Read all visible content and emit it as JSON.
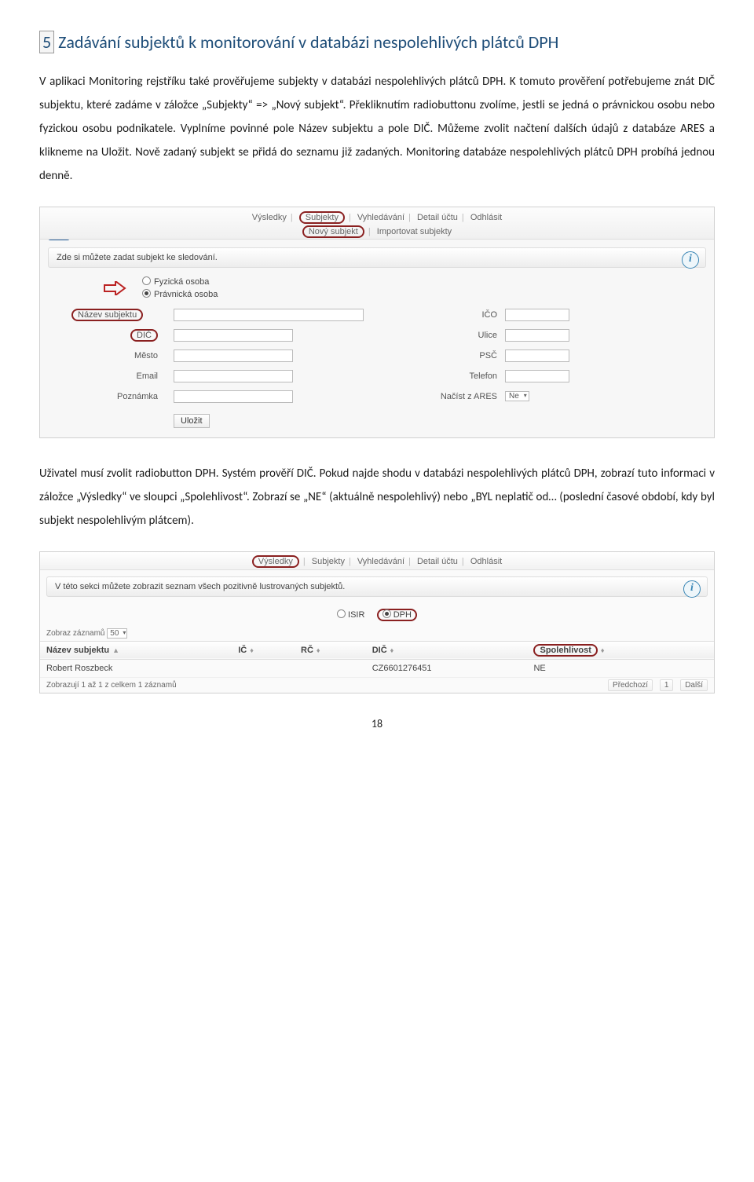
{
  "heading": {
    "num": "5",
    "title": "Zadávání subjektů k monitorování v databázi nespolehlivých plátců DPH"
  },
  "para1": "V aplikaci Monitoring rejstříku také prověřujeme subjekty v databázi nespolehlivých plátců DPH. K tomuto prověření potřebujeme znát DIČ subjektu, které zadáme v záložce „Subjekty“ => „Nový subjekt“. Překliknutím radiobuttonu zvolíme, jestli se jedná o právnickou osobu nebo fyzickou osobu podnikatele. Vyplníme povinné pole Název subjektu a pole DIČ. Můžeme zvolit načtení dalších údajů z databáze ARES a klikneme na Uložit. Nově zadaný subjekt se přidá do seznamu již zadaných. Monitoring databáze nespolehlivých plátců DPH probíhá jednou denně.",
  "para2": "Uživatel musí zvolit radiobutton DPH. Systém prověří DIČ.  Pokud najde shodu v databázi nespolehlivých plátců DPH, zobrazí tuto informaci v záložce „Výsledky“ ve sloupci „Spolehlivost“. Zobrazí se „NE“ (aktuálně nespolehlivý) nebo „BYL neplatič od… (poslední časové období, kdy byl subjekt nespolehlivým plátcem).",
  "pageNumber": "18",
  "shot1": {
    "nav": {
      "vysledky": "Výsledky",
      "subjekty": "Subjekty",
      "vyhledavani": "Vyhledávání",
      "detail": "Detail účtu",
      "odhl": "Odhlásit"
    },
    "subnav": {
      "novy": "Nový subjekt",
      "import": "Importovat subjekty"
    },
    "stripText": "Zde si můžete zadat subjekt ke sledování.",
    "radios": {
      "fyz": "Fyzická osoba",
      "prav": "Právnická osoba"
    },
    "labels": {
      "nazev": "Název subjektu",
      "ico": "IČO",
      "dic": "DIČ",
      "ulice": "Ulice",
      "mesto": "Město",
      "psc": "PSČ",
      "email": "Email",
      "telefon": "Telefon",
      "pozn": "Poznámka",
      "ares": "Načíst z ARES",
      "aresval": "Ne"
    },
    "save": "Uložit"
  },
  "shot2": {
    "nav": {
      "vysledky": "Výsledky",
      "subjekty": "Subjekty",
      "vyhledavani": "Vyhledávání",
      "detail": "Detail účtu",
      "odhl": "Odhlásit"
    },
    "stripText": "V této sekci můžete zobrazit seznam všech pozitivně lustrovaných subjektů.",
    "radios": {
      "isir": "ISIR",
      "dph": "DPH"
    },
    "zobraz": "Zobraz záznamů",
    "zobrazVal": "50",
    "headers": {
      "nazev": "Název subjektu",
      "ic": "IČ",
      "rc": "RČ",
      "dic": "DIČ",
      "spol": "Spolehlivost"
    },
    "row": {
      "nazev": "Robert Roszbeck",
      "ic": "",
      "rc": "",
      "dic": "CZ6601276451",
      "spol": "NE"
    },
    "footer": "Zobrazují 1 až 1 z celkem 1 záznamů",
    "pager": {
      "prev": "Předchozí",
      "one": "1",
      "next": "Další"
    }
  }
}
